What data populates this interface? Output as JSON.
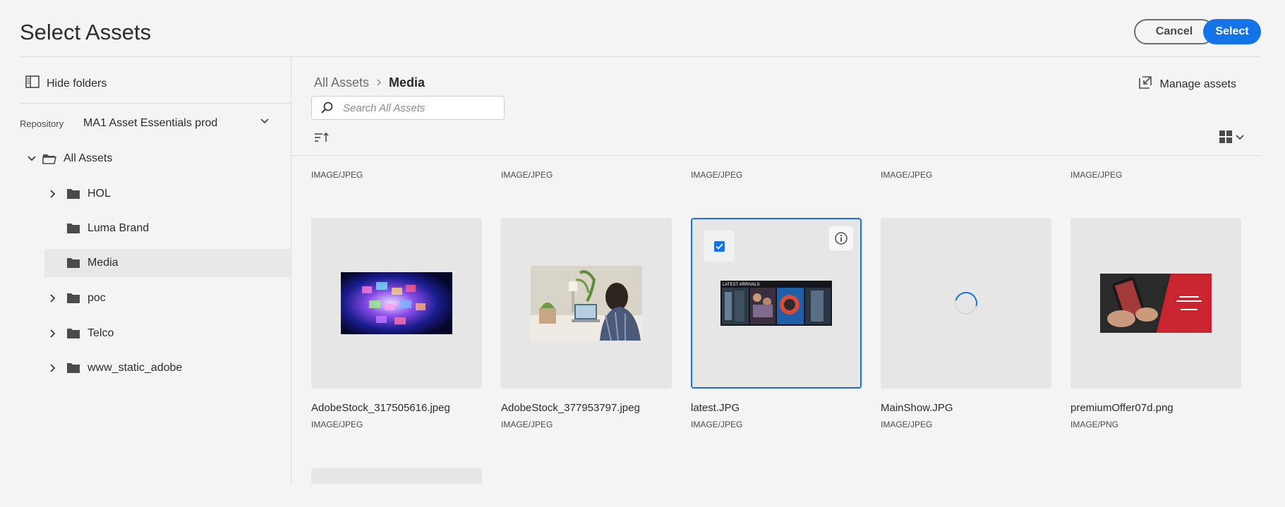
{
  "header": {
    "title": "Select Assets",
    "cancel_label": "Cancel",
    "select_label": "Select",
    "accent_color": "#1473e6"
  },
  "sidebar": {
    "hide_folders_label": "Hide folders",
    "repository_label": "Repository",
    "repository_value": "MA1 Asset Essentials prod",
    "root": "All Assets",
    "folders": [
      {
        "label": "HOL",
        "expandable": true
      },
      {
        "label": "Luma Brand",
        "expandable": false
      },
      {
        "label": "Media",
        "expandable": false,
        "selected": true
      },
      {
        "label": "poc",
        "expandable": true
      },
      {
        "label": "Telco",
        "expandable": true
      },
      {
        "label": "www_static_adobe",
        "expandable": true
      }
    ]
  },
  "main": {
    "breadcrumb_root": "All Assets",
    "breadcrumb_current": "Media",
    "manage_assets_label": "Manage assets",
    "search_placeholder": "Search All Assets",
    "previous_row_types": [
      "IMAGE/JPEG",
      "IMAGE/JPEG",
      "IMAGE/JPEG",
      "IMAGE/JPEG",
      "IMAGE/JPEG"
    ],
    "assets": [
      {
        "name": "AdobeStock_317505616.jpeg",
        "type": "IMAGE/JPEG",
        "thumbnail": "colorful-screens-image"
      },
      {
        "name": "AdobeStock_377953797.jpeg",
        "type": "IMAGE/JPEG",
        "thumbnail": "person-laptop-image"
      },
      {
        "name": "latest.JPG",
        "type": "IMAGE/JPEG",
        "thumbnail": "latest-arrivals-image",
        "selected": true,
        "overlay_text": "LATEST ARRIVALS"
      },
      {
        "name": "MainShow.JPG",
        "type": "IMAGE/JPEG",
        "thumbnail": "loading-spinner"
      },
      {
        "name": "premiumOffer07d.png",
        "type": "IMAGE/PNG",
        "thumbnail": "premium-offer-image"
      }
    ]
  }
}
